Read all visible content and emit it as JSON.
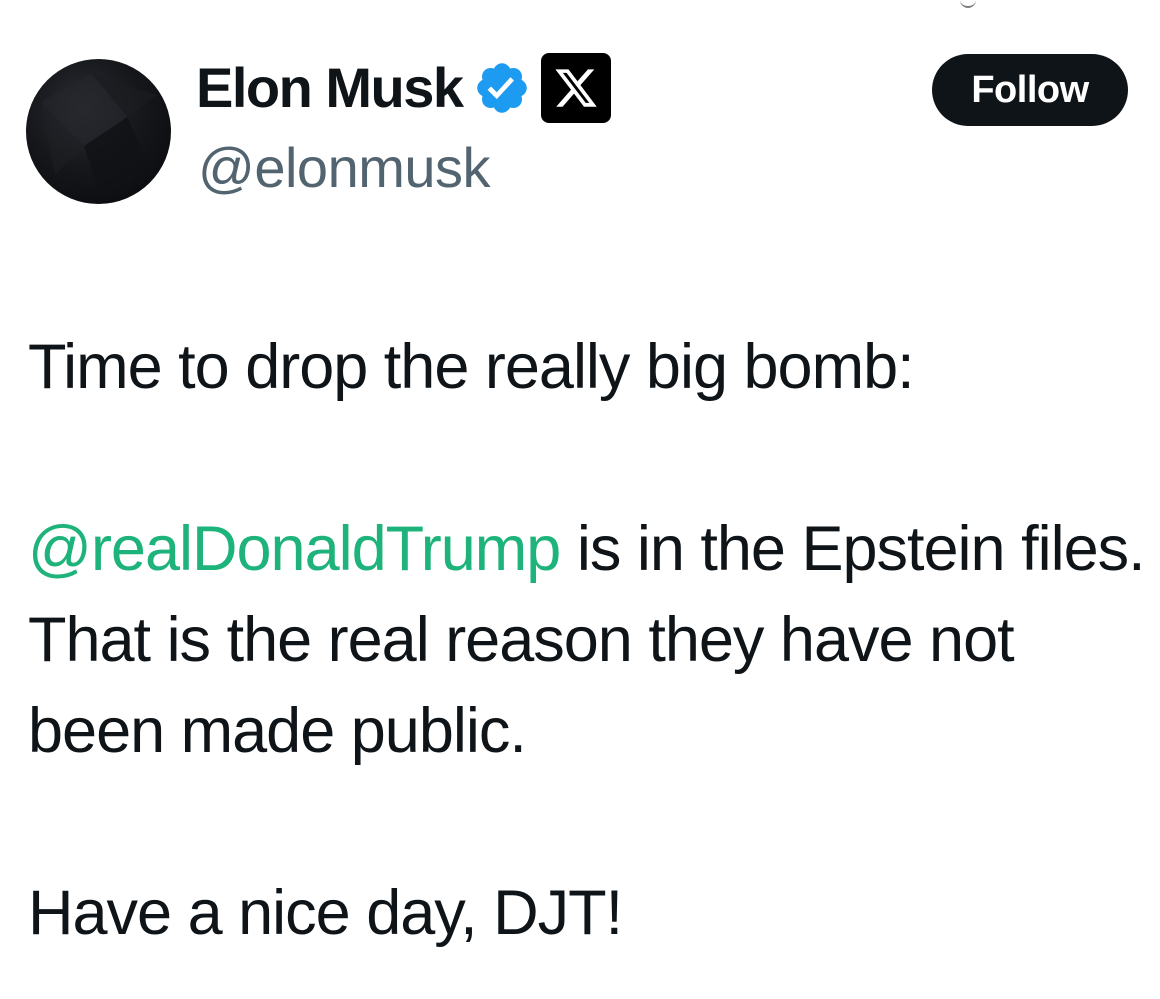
{
  "tweet": {
    "author": {
      "display_name": "Elon Musk",
      "handle": "@elonmusk",
      "verified_icon": "verified-badge-icon",
      "affiliation_icon": "x-logo-icon",
      "avatar": "avatar"
    },
    "follow_label": "Follow",
    "body": {
      "line1": "Time to drop the really big bomb:",
      "mention": "@realDonaldTrump",
      "line2_rest": " is in the Epstein files. That is the real reason they have not been made public.",
      "line3": "Have a nice day, DJT!"
    }
  },
  "colors": {
    "text": "#0f1419",
    "secondary_text": "#536471",
    "mention": "#1db37a",
    "verified_blue": "#1d9bf0",
    "button_bg": "#0f1419",
    "button_text": "#ffffff"
  }
}
